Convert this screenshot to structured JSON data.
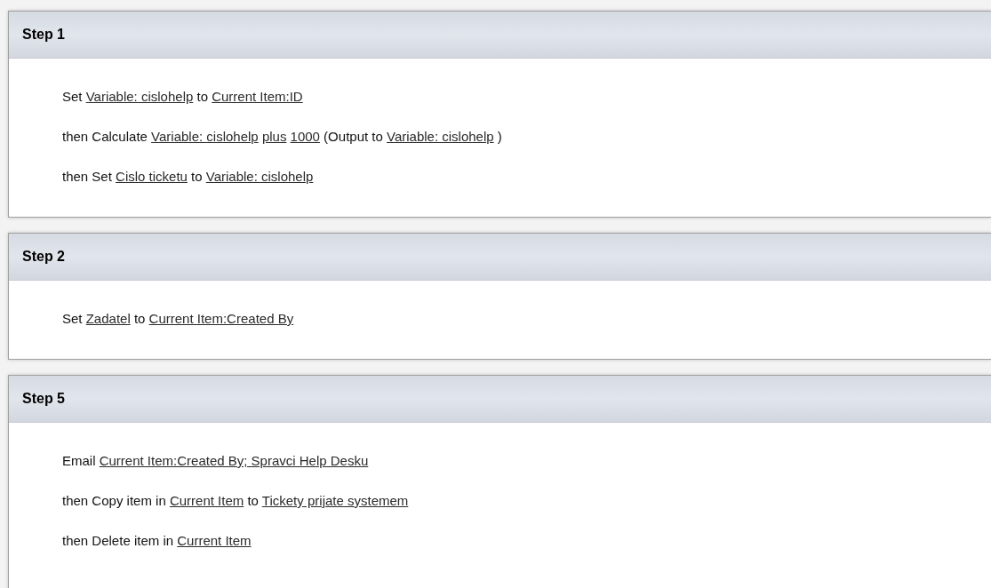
{
  "steps": [
    {
      "title": "Step 1",
      "actions": [
        [
          {
            "kind": "text",
            "text": "Set "
          },
          {
            "kind": "link",
            "text": "Variable: cislohelp"
          },
          {
            "kind": "text",
            "text": " to "
          },
          {
            "kind": "link",
            "text": "Current Item:ID"
          }
        ],
        [
          {
            "kind": "text",
            "text": "then Calculate "
          },
          {
            "kind": "link",
            "text": "Variable: cislohelp"
          },
          {
            "kind": "link",
            "text": "plus"
          },
          {
            "kind": "link",
            "text": "1000"
          },
          {
            "kind": "text",
            "text": " (Output to "
          },
          {
            "kind": "link",
            "text": "Variable: cislohelp"
          },
          {
            "kind": "text",
            "text": " )"
          }
        ],
        [
          {
            "kind": "text",
            "text": "then Set "
          },
          {
            "kind": "link",
            "text": "Cislo ticketu"
          },
          {
            "kind": "text",
            "text": " to "
          },
          {
            "kind": "link",
            "text": "Variable: cislohelp"
          }
        ]
      ]
    },
    {
      "title": "Step 2",
      "actions": [
        [
          {
            "kind": "text",
            "text": "Set "
          },
          {
            "kind": "link",
            "text": "Zadatel"
          },
          {
            "kind": "text",
            "text": " to "
          },
          {
            "kind": "link",
            "text": "Current Item:Created By"
          }
        ]
      ]
    },
    {
      "title": "Step 5",
      "actions": [
        [
          {
            "kind": "text",
            "text": "Email "
          },
          {
            "kind": "link",
            "text": "Current Item:Created By; Spravci Help Desku"
          }
        ],
        [
          {
            "kind": "text",
            "text": "then Copy item in "
          },
          {
            "kind": "link",
            "text": "Current Item"
          },
          {
            "kind": "text",
            "text": " to "
          },
          {
            "kind": "link",
            "text": "Tickety prijate systemem"
          }
        ],
        [
          {
            "kind": "text",
            "text": "then Delete item in "
          },
          {
            "kind": "link",
            "text": "Current Item"
          }
        ]
      ]
    }
  ]
}
